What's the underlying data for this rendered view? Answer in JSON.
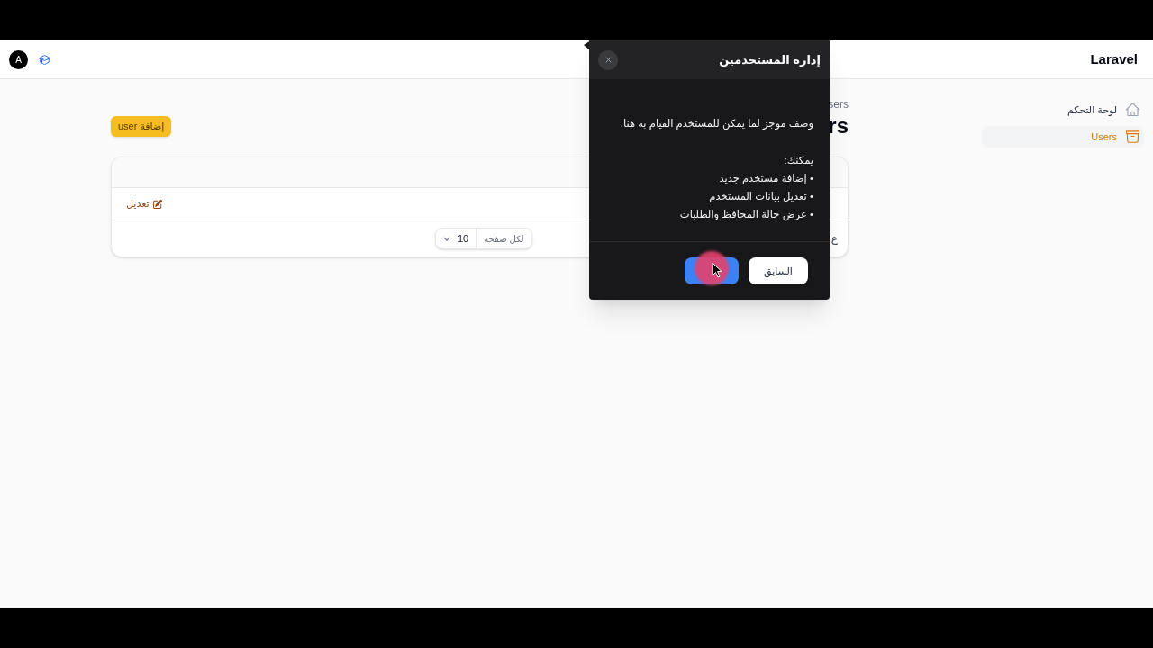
{
  "header": {
    "brand": "Laravel",
    "avatar_initial": "A"
  },
  "sidebar": {
    "items": [
      {
        "label": "لوحة التحكم",
        "selected": false
      },
      {
        "label": "Users",
        "selected": true
      }
    ]
  },
  "page": {
    "breadcrumb": "sers",
    "title": "rs",
    "add_button": "إضافة user"
  },
  "table": {
    "rows": [
      {
        "action": "تعديل"
      }
    ],
    "footer": {
      "summary": "ع",
      "per_page_label": "لكل صفحة",
      "per_page_value": "10"
    }
  },
  "tour_popover": {
    "title": "إدارة المستخدمين",
    "description": "وصف موجز لما يمكن للمستخدم القيام به هنا.",
    "list_heading": "يمكنك:",
    "items": [
      "• إضافة مستخدم جديد",
      "• تعديل بيانات المستخدم",
      "• عرض حالة المحافظ والطلبات"
    ],
    "previous_button": "السابق",
    "next_button": {
      "clicked": true
    }
  }
}
